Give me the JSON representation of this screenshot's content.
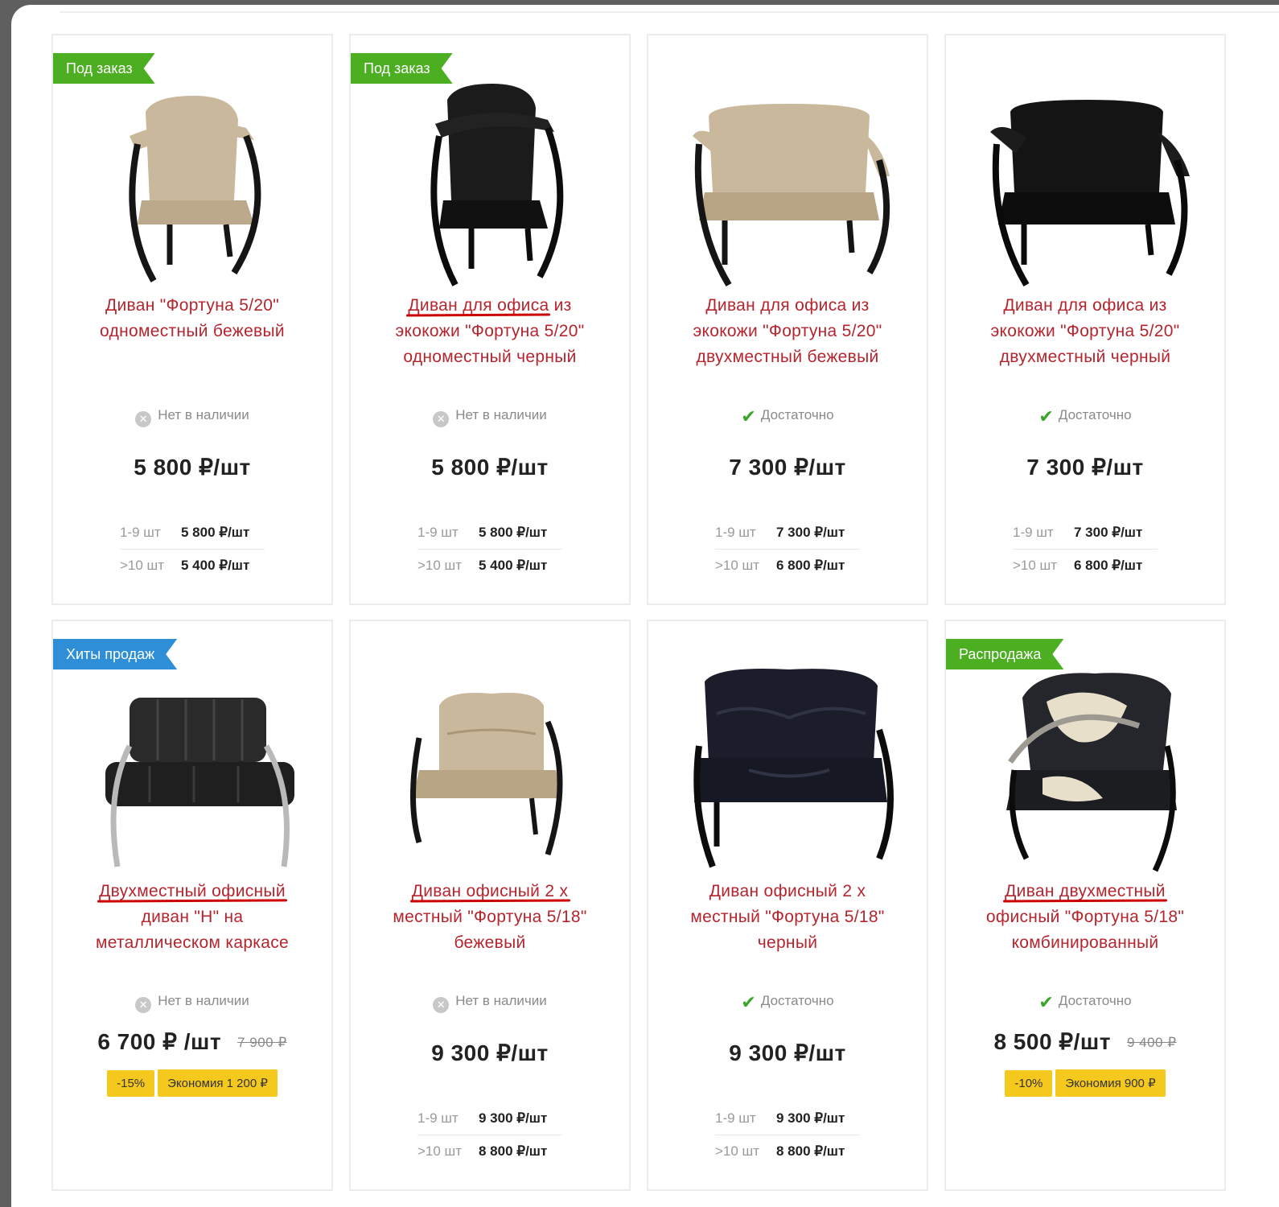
{
  "products": [
    {
      "badge": "Под заказ",
      "badge_color": "green",
      "title_lines": [
        "Диван \"Фортуна 5/20\"",
        "одноместный бежевый"
      ],
      "availability": "Нет в наличии",
      "in_stock": false,
      "price": "5 800 ₽/шт",
      "tiers": [
        {
          "qty": "1-9 шт",
          "price": "5 800 ₽/шт"
        },
        {
          "qty": ">10 шт",
          "price": "5 400 ₽/шт"
        }
      ],
      "image": "beige-armchair"
    },
    {
      "badge": "Под заказ",
      "badge_color": "green",
      "title_parts": [
        [
          "Диван для офиса",
          " из"
        ],
        [
          "экокожи \"Фортуна 5/20\""
        ],
        [
          "одноместный черный"
        ]
      ],
      "title_lines": [
        "Диван для офиса из",
        "экокожи \"Фортуна 5/20\"",
        "одноместный черный"
      ],
      "availability": "Нет в наличии",
      "in_stock": false,
      "price": "5 800 ₽/шт",
      "tiers": [
        {
          "qty": "1-9 шт",
          "price": "5 800 ₽/шт"
        },
        {
          "qty": ">10 шт",
          "price": "5 400 ₽/шт"
        }
      ],
      "image": "black-armchair"
    },
    {
      "title_lines": [
        "Диван для офиса из",
        "экокожи \"Фортуна 5/20\"",
        "двухместный бежевый"
      ],
      "availability": "Достаточно",
      "in_stock": true,
      "price": "7 300 ₽/шт",
      "tiers": [
        {
          "qty": "1-9 шт",
          "price": "7 300 ₽/шт"
        },
        {
          "qty": ">10 шт",
          "price": "6 800 ₽/шт"
        }
      ],
      "image": "beige-sofa"
    },
    {
      "title_lines": [
        "Диван для офиса из",
        "экокожи \"Фортуна 5/20\"",
        "двухместный черный"
      ],
      "availability": "Достаточно",
      "in_stock": true,
      "price": "7 300 ₽/шт",
      "tiers": [
        {
          "qty": "1-9 шт",
          "price": "7 300 ₽/шт"
        },
        {
          "qty": ">10 шт",
          "price": "6 800 ₽/шт"
        }
      ],
      "image": "black-sofa"
    },
    {
      "badge": "Хиты продаж",
      "badge_color": "blue",
      "title_lines": [
        "Двухместный офисный",
        "диван \"Н\" на",
        "металлическом каркасе"
      ],
      "availability": "Нет в наличии",
      "in_stock": false,
      "price": "6 700 ₽ /шт",
      "old_price": "7 900 ₽",
      "discount": "-15%",
      "saving": "Экономия 1 200 ₽",
      "image": "black-sofa-h"
    },
    {
      "title_lines": [
        "Диван офисный 2 х",
        "местный \"Фортуна 5/18\"",
        "бежевый"
      ],
      "availability": "Нет в наличии",
      "in_stock": false,
      "price": "9 300 ₽/шт",
      "tiers": [
        {
          "qty": "1-9 шт",
          "price": "9 300 ₽/шт"
        },
        {
          "qty": ">10 шт",
          "price": "8 800 ₽/шт"
        }
      ],
      "image": "beige-sofa-18"
    },
    {
      "title_lines": [
        "Диван офисный 2 х",
        "местный \"Фортуна 5/18\"",
        "черный"
      ],
      "availability": "Достаточно",
      "in_stock": true,
      "price": "9 300 ₽/шт",
      "tiers": [
        {
          "qty": "1-9 шт",
          "price": "9 300 ₽/шт"
        },
        {
          "qty": ">10 шт",
          "price": "8 800 ₽/шт"
        }
      ],
      "image": "black-sofa-18"
    },
    {
      "badge": "Распродажа",
      "badge_color": "green",
      "title_lines": [
        "Диван двухместный",
        "офисный \"Фортуна 5/18\"",
        "комбинированный"
      ],
      "availability": "Достаточно",
      "in_stock": true,
      "price": "8 500 ₽/шт",
      "old_price": "9 400 ₽",
      "discount": "-10%",
      "saving": "Экономия 900 ₽",
      "image": "combo-sofa-18"
    }
  ],
  "colors": {
    "title": "#b5252e",
    "badge_green": "#4caf22",
    "badge_blue": "#2e8fd8",
    "chip": "#f5c81e",
    "in_stock_check": "#3aa32a"
  }
}
